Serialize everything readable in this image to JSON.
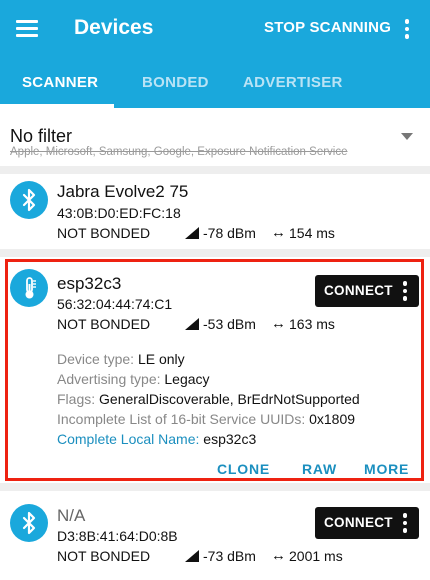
{
  "appbar": {
    "title": "Devices",
    "stop_label": "STOP SCANNING",
    "accent": "#1aa8dc"
  },
  "tabs": [
    {
      "label": "SCANNER"
    },
    {
      "label": "BONDED"
    },
    {
      "label": "ADVERTISER"
    }
  ],
  "active_tab": "SCANNER",
  "filter": {
    "title": "No filter",
    "subtitle": "Apple, Microsoft, Samsung, Google, Exposure Notification Service"
  },
  "devices": [
    {
      "name": "Jabra Evolve2 75",
      "mac": "43:0B:D0:ED:FC:18",
      "status": "NOT BONDED",
      "rssi": "-78 dBm",
      "interval": "154 ms",
      "icon": "bluetooth-icon"
    },
    {
      "name": "esp32c3",
      "mac": "56:32:04:44:74:C1",
      "status": "NOT BONDED",
      "rssi": "-53 dBm",
      "interval": "163 ms",
      "icon": "thermometer-icon",
      "connect_label": "CONNECT",
      "details": [
        {
          "label": "Device type: ",
          "value": "LE only"
        },
        {
          "label": "Advertising type: ",
          "value": "Legacy"
        },
        {
          "label": "Flags: ",
          "value": "GeneralDiscoverable, BrEdrNotSupported"
        },
        {
          "label": "Incomplete List of 16-bit Service UUIDs: ",
          "value": "0x1809"
        },
        {
          "label": "Complete Local Name: ",
          "value": "esp32c3"
        }
      ],
      "actions": {
        "clone": "CLONE",
        "raw": "RAW",
        "more": "MORE"
      }
    },
    {
      "name": "N/A",
      "mac": "D3:8B:41:64:D0:8B",
      "status": "NOT BONDED",
      "rssi": "-73 dBm",
      "interval": "2001 ms",
      "icon": "bluetooth-icon",
      "connect_label": "CONNECT"
    }
  ],
  "colors": {
    "highlight_border": "#ee2211",
    "link": "#1b8fbf"
  }
}
